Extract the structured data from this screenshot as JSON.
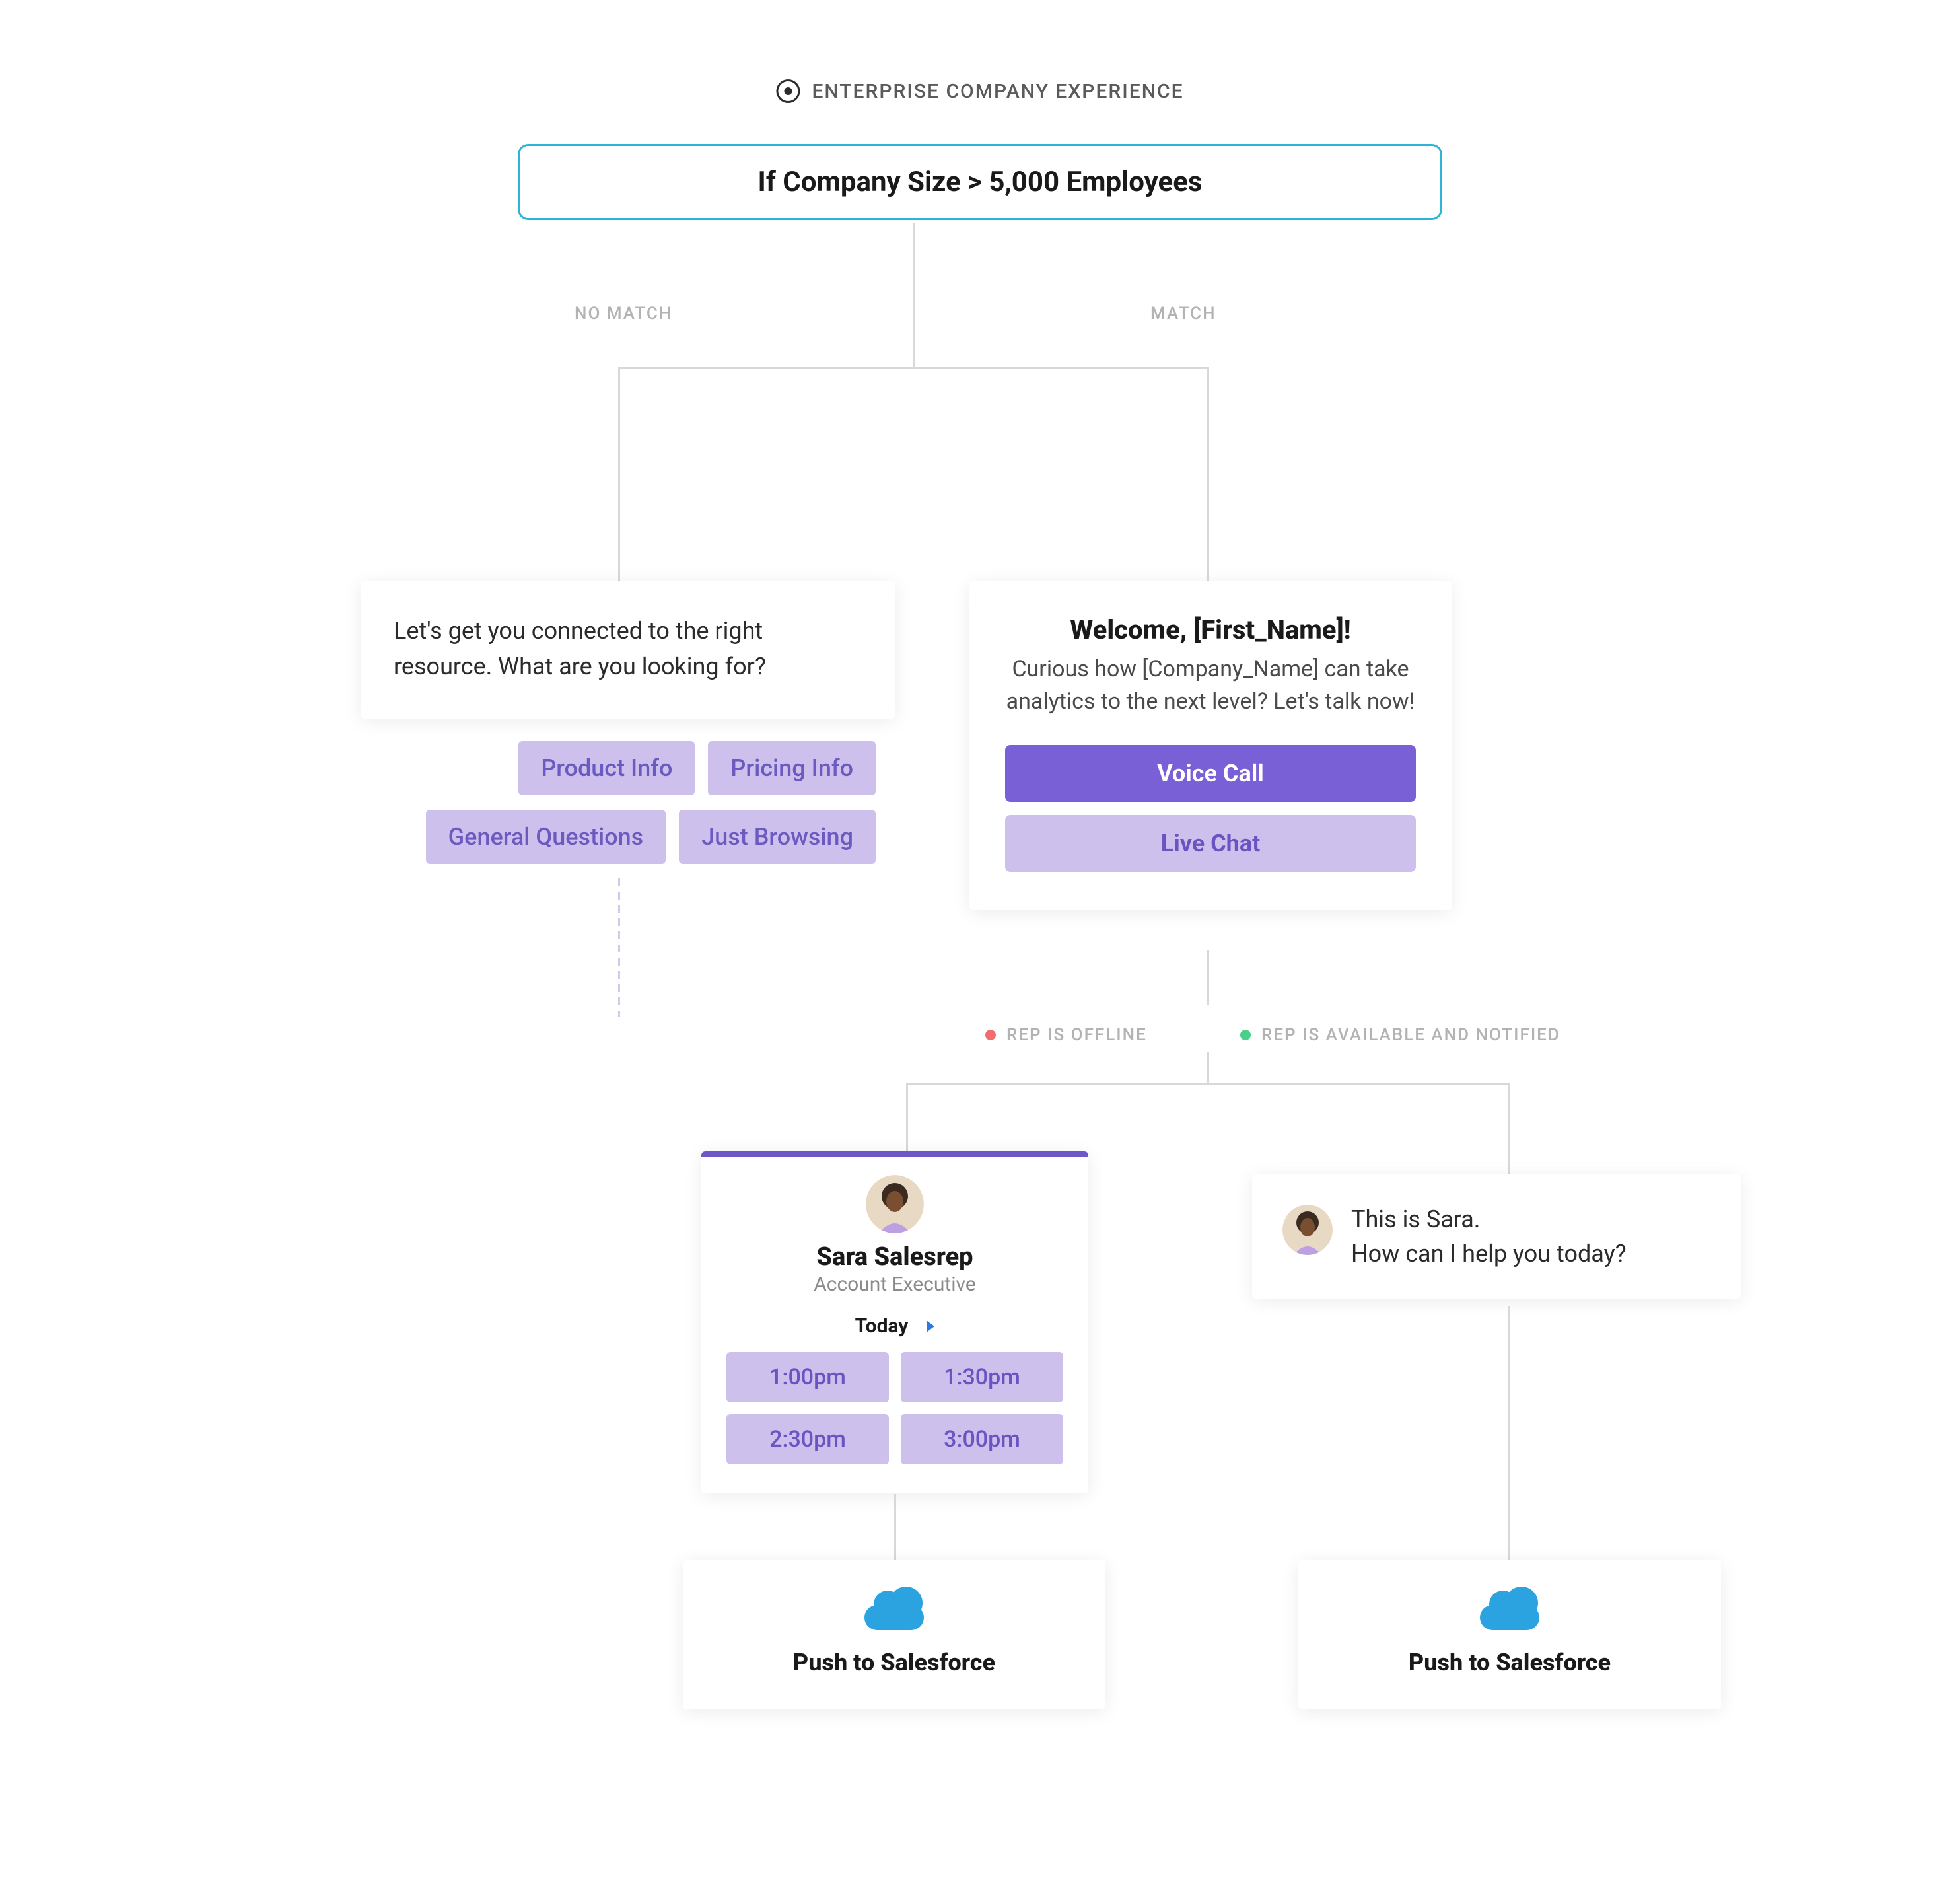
{
  "header": {
    "label": "ENTERPRISE COMPANY EXPERIENCE"
  },
  "condition": {
    "text": "If Company Size > 5,000 Employees"
  },
  "branches": {
    "no_match": "NO MATCH",
    "match": "MATCH"
  },
  "prompt": {
    "text": "Let's get you connected to the right resource. What are you looking for?",
    "chips_row1": [
      "Product Info",
      "Pricing Info"
    ],
    "chips_row2": [
      "General Questions",
      "Just Browsing"
    ]
  },
  "welcome": {
    "title": "Welcome, [First_Name]!",
    "body": "Curious how [Company_Name] can take analytics to the next level? Let's talk now!",
    "primary_btn": "Voice Call",
    "secondary_btn": "Live Chat"
  },
  "status": {
    "offline": "REP IS OFFLINE",
    "available": "REP IS AVAILABLE AND NOTIFIED"
  },
  "scheduler": {
    "rep_name": "Sara Salesrep",
    "rep_title": "Account Executive",
    "today": "Today",
    "slots": [
      "1:00pm",
      "1:30pm",
      "2:30pm",
      "3:00pm"
    ]
  },
  "chat": {
    "line1": "This is Sara.",
    "line2": "How can I help you today?"
  },
  "push": {
    "label": "Push to Salesforce"
  },
  "colors": {
    "accent_border": "#2fb4d8",
    "primary": "#7a60d6",
    "chip_bg": "#cdc0ec",
    "chip_fg": "#6b54c2",
    "cloud": "#2aa3e0"
  }
}
